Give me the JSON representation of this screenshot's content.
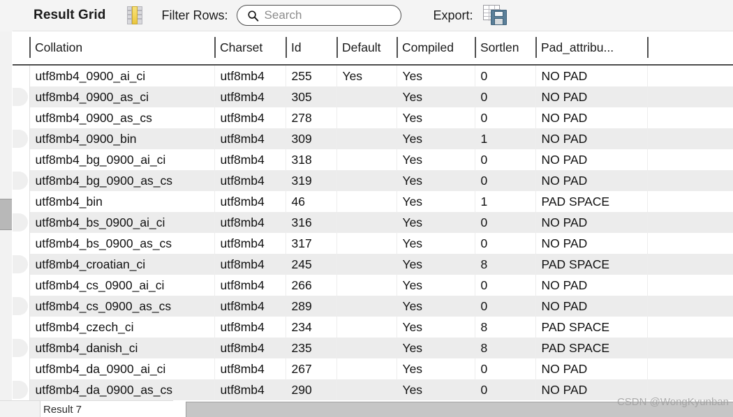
{
  "toolbar": {
    "title": "Result Grid",
    "grid_icon": "grid-toggle-icon",
    "filter_label": "Filter Rows:",
    "search_placeholder": "Search",
    "search_value": "",
    "search_icon": "search-icon",
    "export_label": "Export:",
    "export_icon": "export-save-icon"
  },
  "grid": {
    "columns": [
      {
        "key": "collation",
        "label": "Collation"
      },
      {
        "key": "charset",
        "label": "Charset"
      },
      {
        "key": "id",
        "label": "Id"
      },
      {
        "key": "default",
        "label": "Default"
      },
      {
        "key": "compiled",
        "label": "Compiled"
      },
      {
        "key": "sortlen",
        "label": "Sortlen"
      },
      {
        "key": "pad",
        "label": "Pad_attribu..."
      },
      {
        "key": "extra",
        "label": ""
      }
    ],
    "rows": [
      {
        "collation": "utf8mb4_0900_ai_ci",
        "charset": "utf8mb4",
        "id": "255",
        "default": "Yes",
        "compiled": "Yes",
        "sortlen": "0",
        "pad": "NO PAD",
        "extra": ""
      },
      {
        "collation": "utf8mb4_0900_as_ci",
        "charset": "utf8mb4",
        "id": "305",
        "default": "",
        "compiled": "Yes",
        "sortlen": "0",
        "pad": "NO PAD",
        "extra": ""
      },
      {
        "collation": "utf8mb4_0900_as_cs",
        "charset": "utf8mb4",
        "id": "278",
        "default": "",
        "compiled": "Yes",
        "sortlen": "0",
        "pad": "NO PAD",
        "extra": ""
      },
      {
        "collation": "utf8mb4_0900_bin",
        "charset": "utf8mb4",
        "id": "309",
        "default": "",
        "compiled": "Yes",
        "sortlen": "1",
        "pad": "NO PAD",
        "extra": ""
      },
      {
        "collation": "utf8mb4_bg_0900_ai_ci",
        "charset": "utf8mb4",
        "id": "318",
        "default": "",
        "compiled": "Yes",
        "sortlen": "0",
        "pad": "NO PAD",
        "extra": ""
      },
      {
        "collation": "utf8mb4_bg_0900_as_cs",
        "charset": "utf8mb4",
        "id": "319",
        "default": "",
        "compiled": "Yes",
        "sortlen": "0",
        "pad": "NO PAD",
        "extra": ""
      },
      {
        "collation": "utf8mb4_bin",
        "charset": "utf8mb4",
        "id": "46",
        "default": "",
        "compiled": "Yes",
        "sortlen": "1",
        "pad": "PAD SPACE",
        "extra": ""
      },
      {
        "collation": "utf8mb4_bs_0900_ai_ci",
        "charset": "utf8mb4",
        "id": "316",
        "default": "",
        "compiled": "Yes",
        "sortlen": "0",
        "pad": "NO PAD",
        "extra": ""
      },
      {
        "collation": "utf8mb4_bs_0900_as_cs",
        "charset": "utf8mb4",
        "id": "317",
        "default": "",
        "compiled": "Yes",
        "sortlen": "0",
        "pad": "NO PAD",
        "extra": ""
      },
      {
        "collation": "utf8mb4_croatian_ci",
        "charset": "utf8mb4",
        "id": "245",
        "default": "",
        "compiled": "Yes",
        "sortlen": "8",
        "pad": "PAD SPACE",
        "extra": ""
      },
      {
        "collation": "utf8mb4_cs_0900_ai_ci",
        "charset": "utf8mb4",
        "id": "266",
        "default": "",
        "compiled": "Yes",
        "sortlen": "0",
        "pad": "NO PAD",
        "extra": ""
      },
      {
        "collation": "utf8mb4_cs_0900_as_cs",
        "charset": "utf8mb4",
        "id": "289",
        "default": "",
        "compiled": "Yes",
        "sortlen": "0",
        "pad": "NO PAD",
        "extra": ""
      },
      {
        "collation": "utf8mb4_czech_ci",
        "charset": "utf8mb4",
        "id": "234",
        "default": "",
        "compiled": "Yes",
        "sortlen": "8",
        "pad": "PAD SPACE",
        "extra": ""
      },
      {
        "collation": "utf8mb4_danish_ci",
        "charset": "utf8mb4",
        "id": "235",
        "default": "",
        "compiled": "Yes",
        "sortlen": "8",
        "pad": "PAD SPACE",
        "extra": ""
      },
      {
        "collation": "utf8mb4_da_0900_ai_ci",
        "charset": "utf8mb4",
        "id": "267",
        "default": "",
        "compiled": "Yes",
        "sortlen": "0",
        "pad": "NO PAD",
        "extra": ""
      },
      {
        "collation": "utf8mb4_da_0900_as_cs",
        "charset": "utf8mb4",
        "id": "290",
        "default": "",
        "compiled": "Yes",
        "sortlen": "0",
        "pad": "NO PAD",
        "extra": ""
      }
    ]
  },
  "bottom": {
    "tab_label": "Result 7"
  },
  "watermark": {
    "text": "CSDN @WongKyunban"
  }
}
